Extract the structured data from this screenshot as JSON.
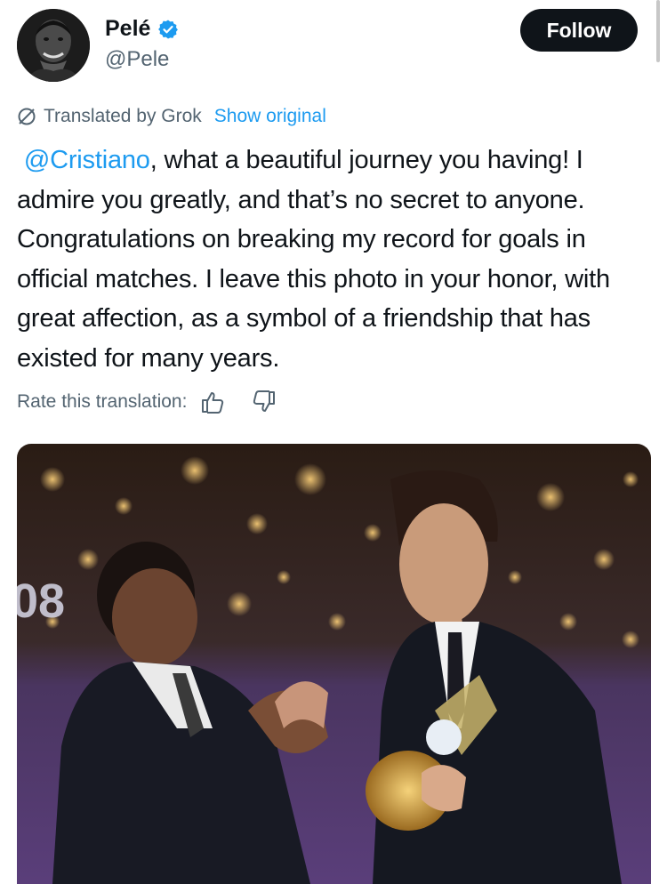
{
  "author": {
    "name": "Pelé",
    "handle": "@Pele",
    "verified": true
  },
  "follow_button": {
    "label": "Follow"
  },
  "translation": {
    "label": "Translated by Grok",
    "show_original": "Show original"
  },
  "tweet": {
    "mention": "@Cristiano",
    "text": ", what a beautiful journey you having! I admire you greatly, and that’s no secret to anyone. Congratulations on breaking my record for goals in official matches. I leave this photo in your honor, with great affection, as a symbol of a friendship that has existed for many years."
  },
  "rate": {
    "label": "Rate this translation:",
    "thumbs_up_icon": "thumbs-up-icon",
    "thumbs_down_icon": "thumbs-down-icon"
  },
  "photo": {
    "background_text": "08"
  },
  "colors": {
    "accent": "#1d9bf0",
    "text": "#0f1419",
    "secondary": "#536471",
    "button_bg": "#0f1419"
  }
}
